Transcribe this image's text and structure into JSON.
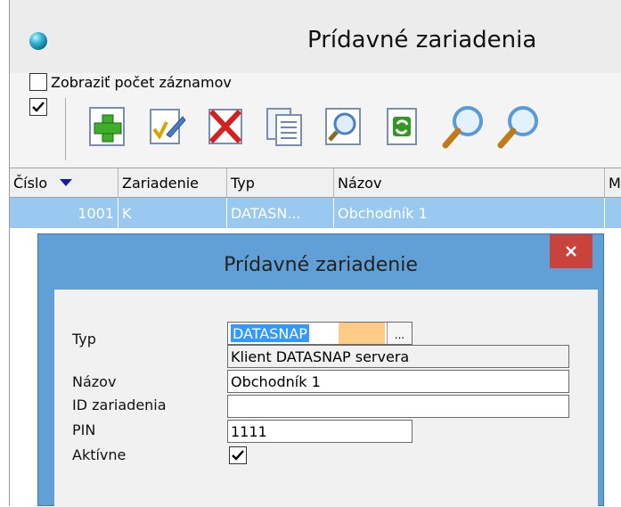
{
  "window": {
    "title": "Prídavné zariadenia"
  },
  "options": {
    "show_count_label": "Zobraziť počet záznamov",
    "show_count_checked": false,
    "toolbar_check_checked": true
  },
  "toolbar": {
    "buttons": [
      "add-icon",
      "edit-icon",
      "delete-icon",
      "copy-icon",
      "preview-icon",
      "refresh-icon",
      "search-icon",
      "search-next-icon"
    ]
  },
  "grid": {
    "columns": [
      "Číslo",
      "Zariadenie",
      "Typ",
      "Názov",
      "M"
    ],
    "sorted_column": "Číslo",
    "rows": [
      {
        "cislo": "1001",
        "zariadenie": "K",
        "typ": "DATASN...",
        "nazov": "Obchodník 1"
      }
    ]
  },
  "dialog": {
    "title": "Prídavné zariadenie",
    "close_label": "×",
    "fields": {
      "typ_label": "Typ",
      "typ_value": "DATASNAP",
      "typ_button": "...",
      "typ_description": "Klient DATASNAP servera",
      "nazov_label": "Názov",
      "nazov_value": "Obchodník 1",
      "id_label": "ID zariadenia",
      "id_value": "",
      "pin_label": "PIN",
      "pin_value": "1111",
      "aktivne_label": "Aktívne",
      "aktivne_checked": true
    }
  },
  "colors": {
    "selection_row": "#99c8f0",
    "dialog_frame": "#60a0d6",
    "close_button": "#c9423b",
    "type_highlight": "#ffcc88",
    "sort_arrow": "#1a1aa8"
  }
}
